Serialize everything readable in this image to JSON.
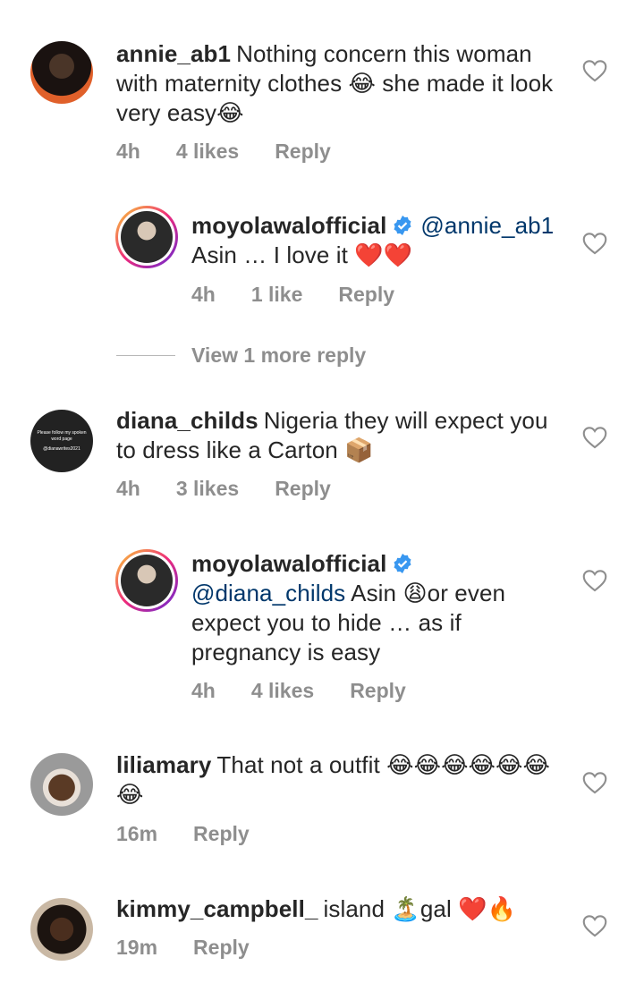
{
  "comments": [
    {
      "username": "annie_ab1",
      "text": "Nothing concern this woman with maternity clothes 😂 she made it look very easy😂",
      "time": "4h",
      "likes": "4 likes",
      "reply": "Reply"
    },
    {
      "username": "moyolawalofficial",
      "mention": "@annie_ab1",
      "text": " Asin … I love it ❤️❤️",
      "time": "4h",
      "likes": "1 like",
      "reply": "Reply"
    },
    {
      "username": "diana_childs",
      "text": "Nigeria they will expect you to dress like a Carton 📦",
      "time": "4h",
      "likes": "3 likes",
      "reply": "Reply",
      "avatar_text": [
        "Please follow my spoken",
        "word page",
        "@dianawrites2021"
      ]
    },
    {
      "username": "moyolawalofficial",
      "mention": "@diana_childs",
      "text": " Asin 😩or even expect you to hide … as if pregnancy is easy",
      "time": "4h",
      "likes": "4 likes",
      "reply": "Reply"
    },
    {
      "username": "liliamary",
      "text": "That not a outfit 😂😂😂😂😂😂😂",
      "time": "16m",
      "reply": "Reply"
    },
    {
      "username": "kimmy_campbell_",
      "text": "island 🏝️gal ❤️🔥",
      "time": "19m",
      "reply": "Reply"
    }
  ],
  "view_more": "View 1 more reply"
}
